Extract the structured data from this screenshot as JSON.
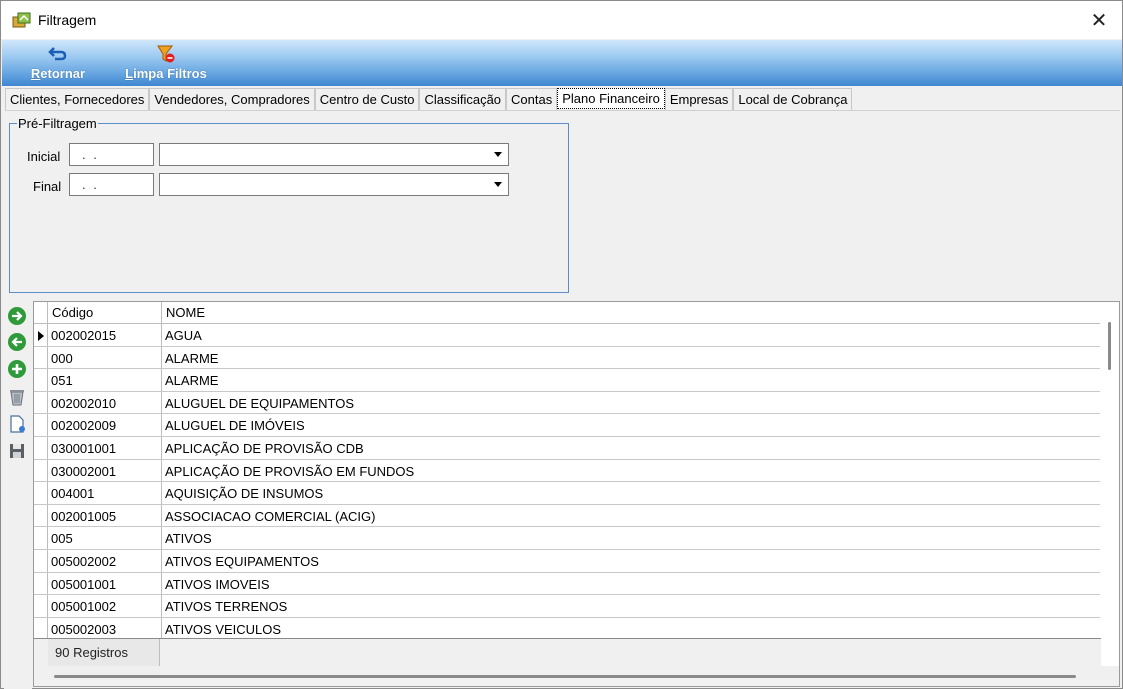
{
  "window": {
    "title": "Filtragem",
    "close_glyph": "✕"
  },
  "toolbar": {
    "retornar": {
      "label_first": "R",
      "label_rest": "etornar",
      "icon": "undo-arrow-icon"
    },
    "limpa": {
      "label_first": "L",
      "label_rest": "impa Filtros",
      "icon": "filter-clear-icon"
    }
  },
  "tabs": [
    {
      "label": "Clientes, Fornecedores",
      "active": false
    },
    {
      "label": "Vendedores, Compradores",
      "active": false
    },
    {
      "label": "Centro de Custo",
      "active": false
    },
    {
      "label": "Classificação",
      "active": false
    },
    {
      "label": "Contas",
      "active": false
    },
    {
      "label": "Plano Financeiro",
      "active": true
    },
    {
      "label": "Empresas",
      "active": false
    },
    {
      "label": "Local de Cobrança",
      "active": false
    }
  ],
  "prefilter": {
    "legend": "Pré-Filtragem",
    "inicial_label": "Inicial",
    "final_label": "Final",
    "inicial_value": ". .",
    "final_value": ". ."
  },
  "grid": {
    "columns": [
      "Código",
      "NOME"
    ],
    "rows": [
      [
        "002002015",
        "AGUA"
      ],
      [
        "000",
        "ALARME"
      ],
      [
        "051",
        "ALARME"
      ],
      [
        "002002010",
        "ALUGUEL DE EQUIPAMENTOS"
      ],
      [
        "002002009",
        "ALUGUEL DE IMÓVEIS"
      ],
      [
        "030001001",
        "APLICAÇÃO DE PROVISÃO CDB"
      ],
      [
        "030002001",
        "APLICAÇÃO DE PROVISÃO EM FUNDOS"
      ],
      [
        "004001",
        "AQUISIÇÃO DE INSUMOS"
      ],
      [
        "002001005",
        "ASSOCIACAO COMERCIAL (ACIG)"
      ],
      [
        "005",
        "ATIVOS"
      ],
      [
        "005002002",
        "ATIVOS EQUIPAMENTOS"
      ],
      [
        "005001001",
        "ATIVOS IMOVEIS"
      ],
      [
        "005001002",
        "ATIVOS TERRENOS"
      ],
      [
        "005002003",
        "ATIVOS VEICULOS"
      ]
    ],
    "selected_row": 0,
    "footer": "90 Registros"
  },
  "sidebar_icons": [
    "arrow-right-icon",
    "arrow-left-icon",
    "add-icon",
    "trash-icon",
    "new-document-icon",
    "save-icon"
  ],
  "colors": {
    "toolbar_top": "#cfe6fb",
    "toolbar_bottom": "#3f86d1",
    "group_border": "#5a8ec8",
    "nav_green": "#2e9a3a"
  }
}
